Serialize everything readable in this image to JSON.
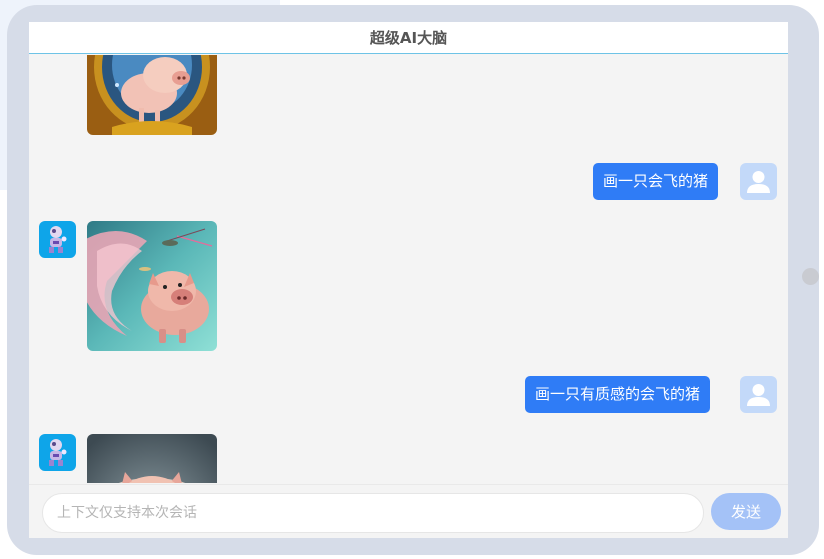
{
  "header": {
    "title": "超级AI大脑"
  },
  "messages": [
    {
      "role": "bot",
      "type": "image",
      "subject": "pig-portrait"
    },
    {
      "role": "user",
      "type": "text",
      "text": "画一只会飞的猪"
    },
    {
      "role": "bot",
      "type": "image",
      "subject": "flying-pig"
    },
    {
      "role": "user",
      "type": "text",
      "text": "画一只有质感的会飞的猪"
    },
    {
      "role": "bot",
      "type": "image",
      "subject": "textured-pig"
    }
  ],
  "input": {
    "placeholder": "上下文仅支持本次会话",
    "value": ""
  },
  "send_label": "发送",
  "colors": {
    "accent": "#2f7cf6",
    "send_disabled": "#a4c2f7",
    "bot_avatar": "#0ea5e9",
    "user_avatar": "#c3d9f9"
  }
}
